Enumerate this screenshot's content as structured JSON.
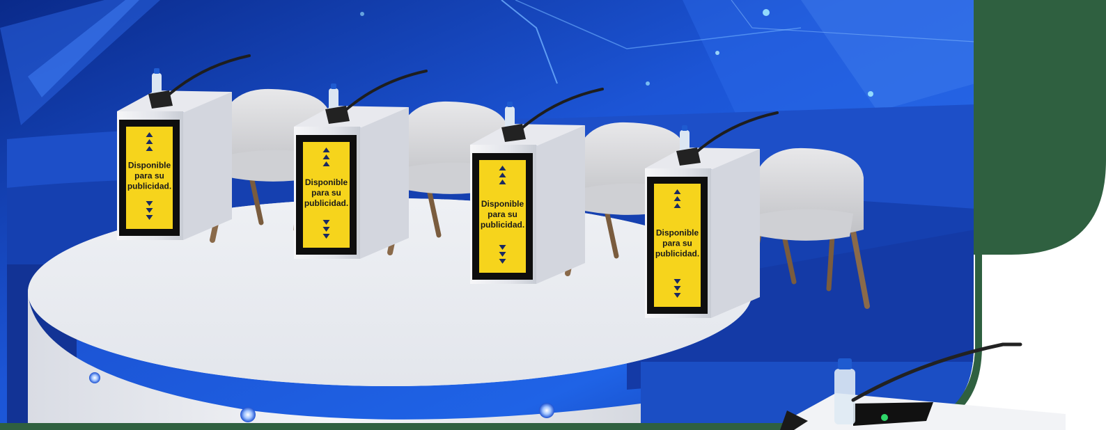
{
  "scene": {
    "description_free": true,
    "colors": {
      "frame_green": "#2f6040",
      "stage_blue_dark": "#0b2a86",
      "stage_blue_light": "#2a6ae0",
      "platform_white": "#f1f2f5",
      "sign_yellow": "#f6d41c",
      "sign_black": "#0e0e0e"
    },
    "podium_signs": [
      {
        "line1": "Disponible",
        "line2": "para su",
        "line3": "publicidad."
      },
      {
        "line1": "Disponible",
        "line2": "para su",
        "line3": "publicidad."
      },
      {
        "line1": "Disponible",
        "line2": "para su",
        "line3": "publicidad."
      },
      {
        "line1": "Disponible",
        "line2": "para su",
        "line3": "publicidad."
      }
    ],
    "icons": {
      "arrow_up": "triangle-up-icon",
      "arrow_down": "triangle-down-icon"
    }
  }
}
